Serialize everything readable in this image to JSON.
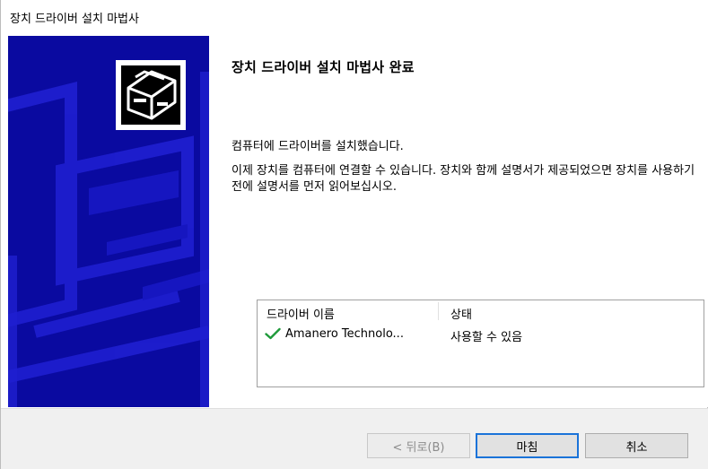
{
  "window": {
    "title": "장치 드라이버 설치 마법사"
  },
  "content": {
    "heading": "장치 드라이버 설치 마법사 완료",
    "paragraph1": "컴퓨터에 드라이버를 설치했습니다.",
    "paragraph2": "이제 장치를 컴퓨터에 연결할 수 있습니다. 장치와 함께 설명서가 제공되었으면 장치를 사용하기 전에 설명서를 먼저 읽어보십시오."
  },
  "driver_list": {
    "columns": [
      "드라이버 이름",
      "상태"
    ],
    "rows": [
      {
        "name": "Amanero Technolo...",
        "status": "사용할 수 있음",
        "icon": "checkmark-icon"
      }
    ]
  },
  "buttons": {
    "back": "< 뒤로(B)",
    "finish": "마침",
    "cancel": "취소"
  },
  "colors": {
    "side_panel": "#0a0aa0",
    "check": "#1f9a3a",
    "default_button_border": "#1a73d9"
  }
}
